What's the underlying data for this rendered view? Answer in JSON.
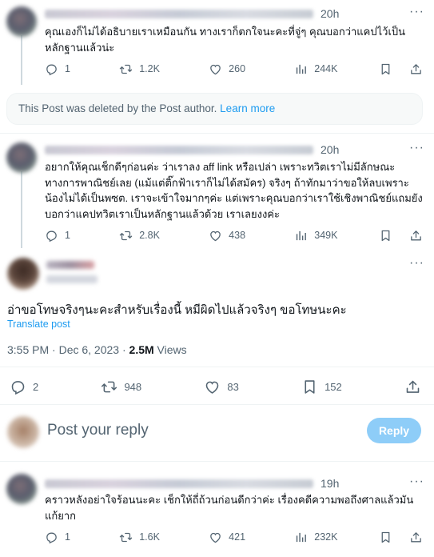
{
  "posts": [
    {
      "time": "20h",
      "text": "คุณเองก็ไม่ได้อธิบายเราเหมือนกัน ทางเราก็ตกใจนะคะที่จู่ๆ คุณบอกว่าแคปไว้เป็นหลักฐานแล้วน่ะ",
      "replies": "1",
      "reposts": "1.2K",
      "likes": "260",
      "views": "244K"
    },
    {
      "time": "20h",
      "text": "อยากให้คุณเช็กดีๆก่อนค่ะ ว่าเราลง aff link หรือเปล่า เพราะทวิตเราไม่มีลักษณะทางการพาณิชย์เลย (แม้แต่ติ๊กฟ้าเราก็ไม่ได้สมัคร) จริงๆ ถ้าทักมาว่าขอให้ลบเพราะน้องไม่ได้เป็นพซต. เราจะเข้าใจมากๆค่ะ แต่เพราะคุณบอกว่าเราใช้เชิงพาณิชย์แถมยังบอกว่าแคปทวิตเราเป็นหลักฐานแล้วด้วย เราเลยงงค่ะ",
      "replies": "1",
      "reposts": "2.8K",
      "likes": "438",
      "views": "349K"
    },
    {
      "time": "19h",
      "text": "คราวหลังอย่าใจร้อนนะคะ เช็กให้ถี่ถ้วนก่อนดีกว่าค่ะ เรื่องคดีความพอถึงศาลแล้วมันแก้ยาก",
      "replies": "1",
      "reposts": "1.6K",
      "likes": "421",
      "views": "232K"
    }
  ],
  "deleted_notice": {
    "text": "This Post was deleted by the Post author.",
    "link": "Learn more"
  },
  "main_post": {
    "text": "อ่าขอโทษจริงๆนะคะสำหรับเรื่องนี้ หมีผิดไปแล้วจริงๆ ขอโทษนะคะ",
    "translate": "Translate post",
    "time_date": "3:55 PM · Dec 6, 2023 · ",
    "views_count": "2.5M",
    "views_label": " Views",
    "replies": "2",
    "reposts": "948",
    "likes": "83",
    "bookmarks": "152"
  },
  "reply_box": {
    "placeholder": "Post your reply",
    "button": "Reply"
  },
  "colors": {
    "accent": "#1d9bf0",
    "muted": "#536471",
    "reply_button_disabled": "#8ecdf8"
  },
  "icons": [
    "reply-icon",
    "repost-icon",
    "like-icon",
    "views-icon",
    "bookmark-icon",
    "share-icon",
    "more-icon"
  ]
}
